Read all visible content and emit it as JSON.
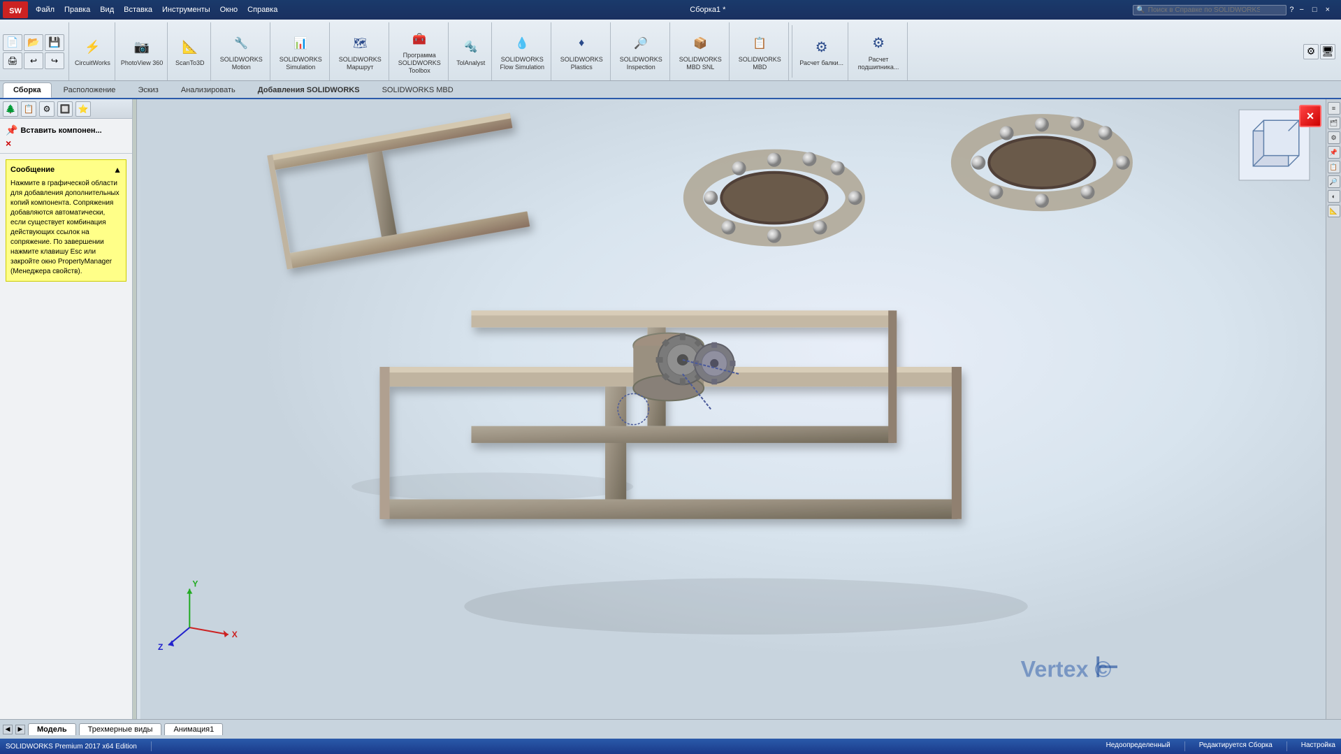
{
  "titlebar": {
    "logo_text": "SW",
    "menus": [
      "Файл",
      "Правка",
      "Вид",
      "Вставка",
      "Инструменты",
      "Окно",
      "Справка"
    ],
    "title": "Сборка1 *",
    "search_placeholder": "Поиск в Справке по SOLIDWORKS",
    "controls": [
      "?",
      "−",
      "□",
      "×"
    ]
  },
  "commandbar": {
    "tools": [
      {
        "icon": "⚡",
        "label": "CircuitWorks"
      },
      {
        "icon": "📷",
        "label": "PhotoView 360"
      },
      {
        "icon": "📐",
        "label": "ScanTo3D"
      },
      {
        "icon": "🔧",
        "label": "SOLIDWORKS Motion"
      },
      {
        "icon": "📊",
        "label": "SOLIDWORKS Simulation"
      },
      {
        "icon": "🗺",
        "label": "SOLIDWORKS Маршрут"
      },
      {
        "icon": "🔬",
        "label": "Программа SOLIDWORKS Toolbox"
      },
      {
        "icon": "🔩",
        "label": "TolAnalyst"
      },
      {
        "icon": "💧",
        "label": "SOLIDWORKS Flow Simulation"
      },
      {
        "icon": "♦",
        "label": "SOLIDWORKS Plastics"
      },
      {
        "icon": "🔎",
        "label": "SOLIDWORKS Inspection"
      },
      {
        "icon": "📦",
        "label": "SOLIDWORKS MBD SNL"
      },
      {
        "icon": "📋",
        "label": "SOLIDWORKS MBD"
      },
      {
        "icon": "⚙",
        "label": "Расчет балки..."
      },
      {
        "icon": "⚙",
        "label": "Расчет подшипника..."
      }
    ]
  },
  "ribbontabs": {
    "tabs": [
      "Сборка",
      "Расположение",
      "Эскиз",
      "Анализировать",
      "Добавления SOLIDWORKS",
      "SOLIDWORKS MBD"
    ],
    "active_tab": "Сборка"
  },
  "leftpanel": {
    "title": "Вставить компонен...",
    "close_label": "×",
    "message_header": "Сообщение",
    "message_text": "Нажмите в графической области для добавления дополнительных копий компонента. Сопряжения добавляются автоматически, если существует комбинация действующих ссылок на сопряжение. По завершении нажмите клавишу Esc или закройте окно PropertyManager (Менеджера свойств)."
  },
  "viewport": {
    "close_btn": "×"
  },
  "bottomtabs": {
    "tabs": [
      "Модель",
      "Трехмерные виды",
      "Анимация1"
    ],
    "active_tab": "Модель"
  },
  "statusbar": {
    "edition": "SOLIDWORKS Premium 2017 x64 Edition",
    "status1": "Недоопределенный",
    "status2": "Редактируется Сборка",
    "status3": "Настройка"
  }
}
